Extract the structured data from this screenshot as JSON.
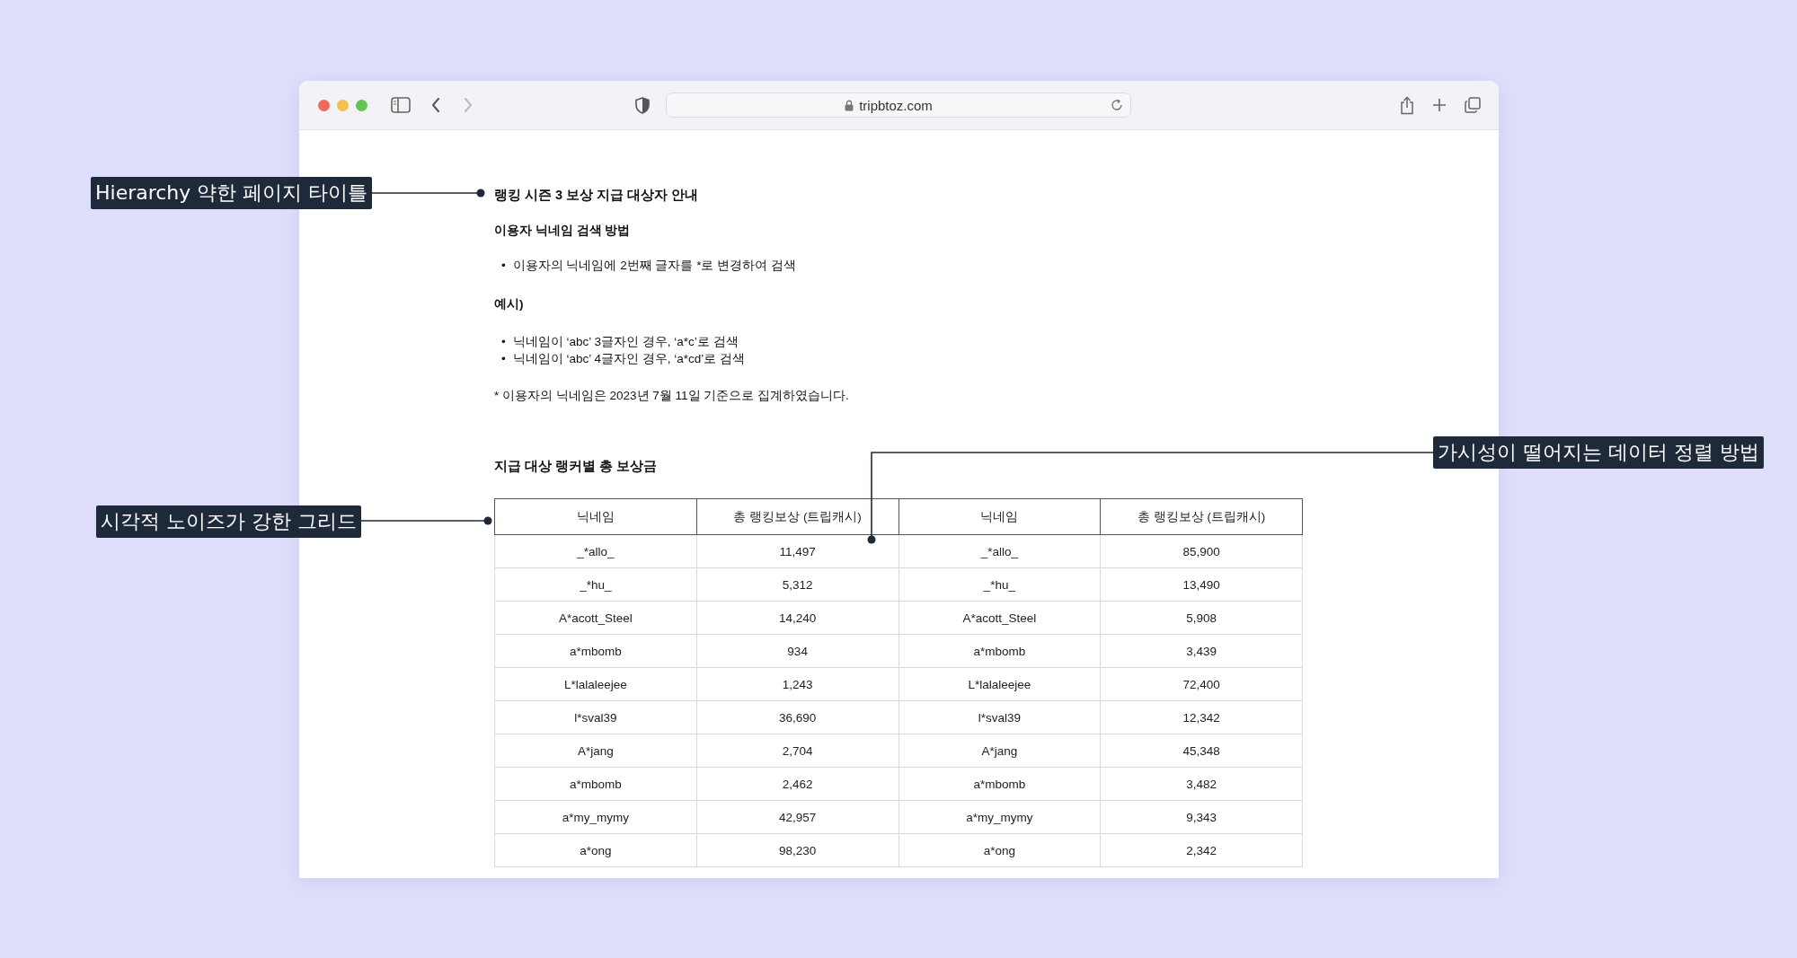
{
  "browser": {
    "url": "tripbtoz.com"
  },
  "page": {
    "title": "랭킹 시즌 3 보상 지급 대상자 안내",
    "subtitle": "이용자 닉네임 검색 방법",
    "method_bullets": [
      {
        "marker": "•",
        "text": "이용자의 닉네임에 2번째 글자를 *로 변경하여 검색"
      }
    ],
    "example_label": "예시)",
    "example_bullets": [
      {
        "marker": "•",
        "text": "닉네임이 ‘abc’ 3글자인 경우, ‘a*c’로 검색"
      },
      {
        "marker": "•",
        "text": "닉네임이 ‘abc’ 4글자인 경우, ‘a*cd’로 검색"
      }
    ],
    "note": "* 이용자의 닉네임은 2023년 7월 11일 기준으로 집계하였습니다."
  },
  "table": {
    "title": "지급 대상 랭커별 총 보상금",
    "columns": [
      "닉네임",
      "총 랭킹보상 (트립캐시)",
      "닉네임",
      "총 랭킹보상 (트립캐시)"
    ],
    "rows": [
      [
        "_*allo_",
        "11,497",
        "_*allo_",
        "85,900"
      ],
      [
        "_*hu_",
        "5,312",
        "_*hu_",
        "13,490"
      ],
      [
        "A*acott_Steel",
        "14,240",
        "A*acott_Steel",
        "5,908"
      ],
      [
        "a*mbomb",
        "934",
        "a*mbomb",
        "3,439"
      ],
      [
        "L*lalaleejee",
        "1,243",
        "L*lalaleejee",
        "72,400"
      ],
      [
        "l*sval39",
        "36,690",
        "l*sval39",
        "12,342"
      ],
      [
        "A*jang",
        "2,704",
        "A*jang",
        "45,348"
      ],
      [
        "a*mbomb",
        "2,462",
        "a*mbomb",
        "3,482"
      ],
      [
        "a*my_mymy",
        "42,957",
        "a*my_mymy",
        "9,343"
      ],
      [
        "a*ong",
        "98,230",
        "a*ong",
        "2,342"
      ]
    ]
  },
  "annotations": [
    {
      "text": "Hierarchy 약한 페이지 타이틀"
    },
    {
      "text": "시각적 노이즈가 강한 그리드"
    },
    {
      "text": "가시성이 떨어지는 데이터 정렬 방법"
    }
  ]
}
